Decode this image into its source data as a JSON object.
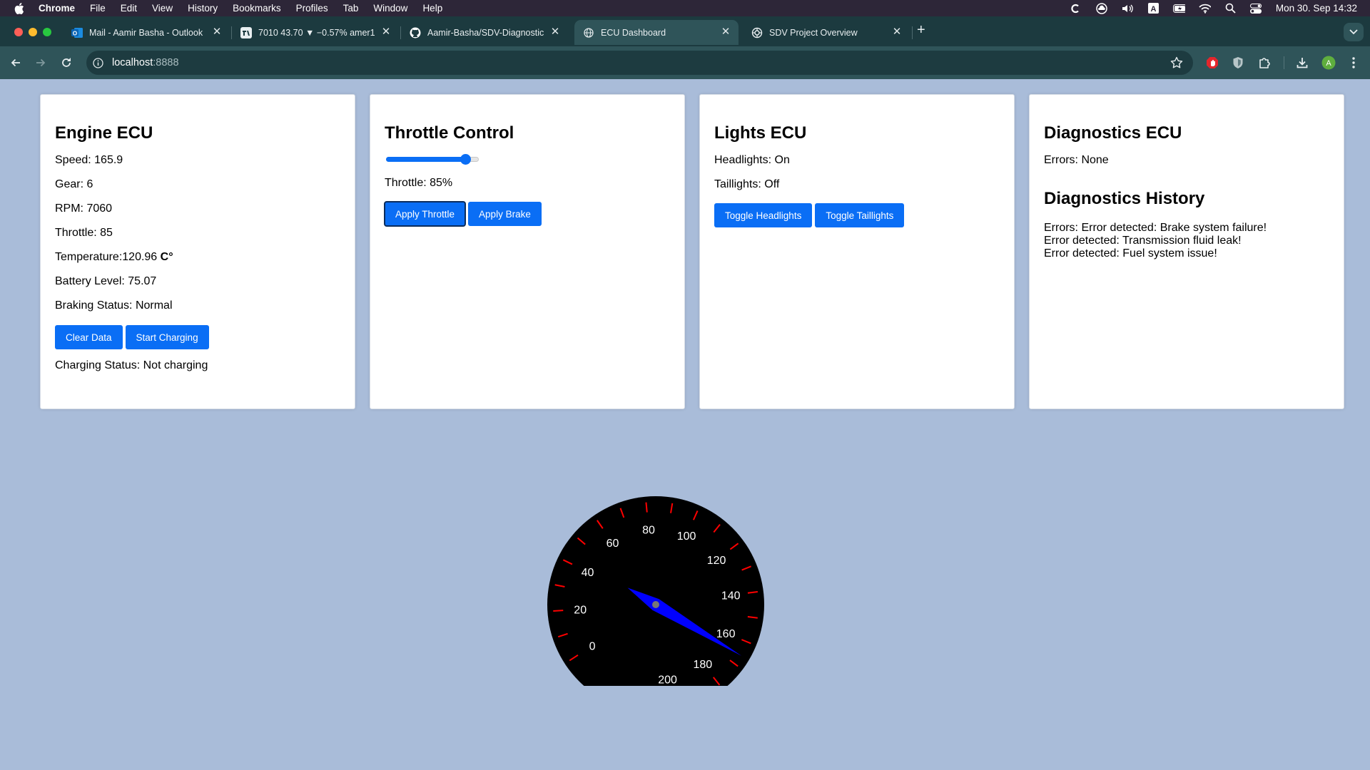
{
  "menubar": {
    "app_name": "Chrome",
    "items": [
      "File",
      "Edit",
      "View",
      "History",
      "Bookmarks",
      "Profiles",
      "Tab",
      "Window",
      "Help"
    ],
    "clock": "Mon 30. Sep  14:32"
  },
  "tabs": [
    {
      "title": "Mail - Aamir Basha - Outlook",
      "icon": "outlook-icon",
      "active": false
    },
    {
      "title": "7010 43.70 ▼ −0.57% amer1",
      "icon": "tradingview-icon",
      "active": false
    },
    {
      "title": "Aamir-Basha/SDV-Diagnostic",
      "icon": "github-icon",
      "active": false
    },
    {
      "title": "ECU Dashboard",
      "icon": "globe-icon",
      "active": true
    },
    {
      "title": "SDV Project Overview",
      "icon": "chatgpt-icon",
      "active": false
    }
  ],
  "address": {
    "host": "localhost",
    "port": ":8888"
  },
  "engine": {
    "title": "Engine ECU",
    "speed": "Speed: 165.9",
    "gear": "Gear: 6",
    "rpm": "RPM: 7060",
    "throttle": "Throttle: 85",
    "temperature_label": "Temperature:120.96 ",
    "temperature_unit": "C°",
    "battery": "Battery Level: 75.07",
    "braking": "Braking Status: Normal",
    "clear_label": "Clear Data",
    "charge_label": "Start Charging",
    "charging_status": "Charging Status: Not charging"
  },
  "throttle_control": {
    "title": "Throttle Control",
    "value_percent": 85,
    "value_text": "Throttle: 85%",
    "apply_throttle_label": "Apply Throttle",
    "apply_brake_label": "Apply Brake"
  },
  "lights": {
    "title": "Lights ECU",
    "headlights": "Headlights: On",
    "taillights": "Taillights: Off",
    "toggle_head_label": "Toggle Headlights",
    "toggle_tail_label": "Toggle Taillights"
  },
  "diagnostics": {
    "title": "Diagnostics ECU",
    "errors": "Errors: None",
    "history_title": "Diagnostics History",
    "history": [
      "Errors: Error detected: Brake system failure!",
      "Error detected: Transmission fluid leak!",
      "Error detected: Fuel system issue!"
    ]
  },
  "speedometer": {
    "labels": [
      "0",
      "20",
      "40",
      "60",
      "80",
      "100",
      "120",
      "140",
      "160",
      "180",
      "200"
    ],
    "speed": 165.9,
    "needle_color": "#0000ff",
    "tick_color": "#ff0000"
  },
  "colors": {
    "accent": "#0a6ef5",
    "page_bg": "#a9bcd9"
  }
}
